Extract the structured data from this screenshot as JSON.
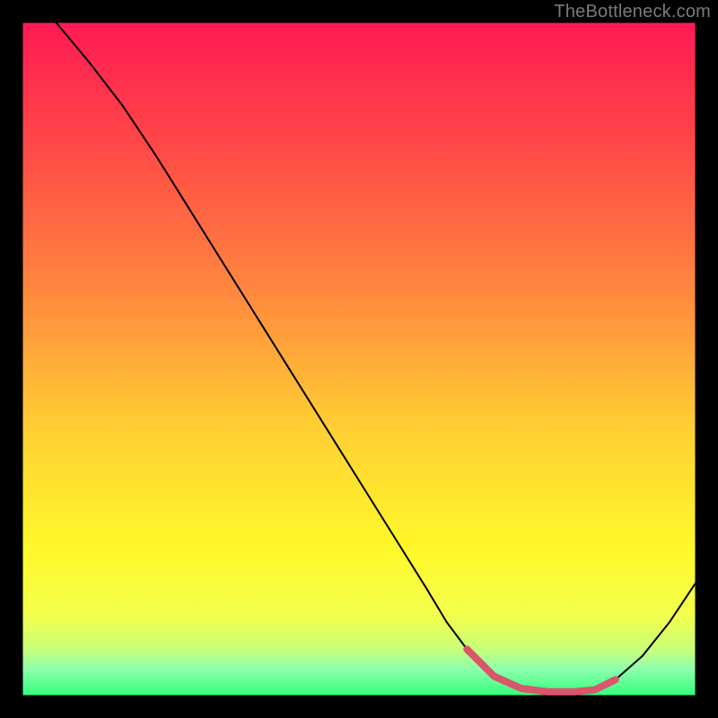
{
  "watermark": "TheBottleneck.com",
  "chart_data": {
    "type": "line",
    "title": "",
    "xlabel": "",
    "ylabel": "",
    "xlim": [
      0,
      100
    ],
    "ylim": [
      0,
      100
    ],
    "grid": false,
    "legend": false,
    "background_gradient": {
      "stops": [
        {
          "offset": 0.0,
          "color": "#ff1a54"
        },
        {
          "offset": 0.18,
          "color": "#ff4747"
        },
        {
          "offset": 0.4,
          "color": "#ff883e"
        },
        {
          "offset": 0.6,
          "color": "#ffce33"
        },
        {
          "offset": 0.78,
          "color": "#fff82a"
        },
        {
          "offset": 0.88,
          "color": "#f3ff4c"
        },
        {
          "offset": 0.93,
          "color": "#c8ff7a"
        },
        {
          "offset": 0.96,
          "color": "#8dffad"
        },
        {
          "offset": 1.0,
          "color": "#2fff7a"
        }
      ]
    },
    "series": [
      {
        "name": "bottleneck-curve",
        "color": "#000000",
        "width": 2,
        "x": [
          5,
          10,
          15,
          20,
          25,
          30,
          35,
          40,
          45,
          50,
          55,
          60,
          63,
          66,
          70,
          74,
          78,
          82,
          85,
          88,
          92,
          96,
          100
        ],
        "y": [
          100,
          94,
          87.5,
          80,
          72,
          64,
          56,
          48,
          40,
          32,
          24,
          16,
          11,
          7,
          3,
          1.2,
          0.7,
          0.7,
          1.0,
          2.5,
          6,
          11,
          17
        ]
      },
      {
        "name": "optimal-zone-marker",
        "color": "#d9566b",
        "width": 8,
        "linecap": "round",
        "x": [
          66,
          70,
          74,
          78,
          82,
          85,
          88
        ],
        "y": [
          7,
          3,
          1.2,
          0.7,
          0.7,
          1.0,
          2.5
        ]
      }
    ],
    "axes_box": {
      "stroke": "#000000",
      "width": 3
    }
  }
}
